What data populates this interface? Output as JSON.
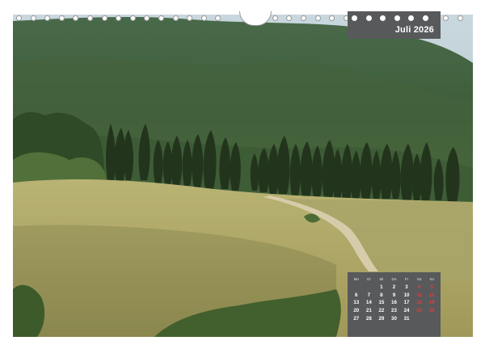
{
  "calendar": {
    "month_title": "Juli 2026",
    "weekday_headers": [
      "Mo",
      "Di",
      "Mi",
      "Do",
      "Fr",
      "Sa",
      "So"
    ],
    "weeks": [
      [
        "",
        "",
        "1",
        "2",
        "3",
        "4",
        "5"
      ],
      [
        "6",
        "7",
        "8",
        "9",
        "10",
        "11",
        "12"
      ],
      [
        "13",
        "14",
        "15",
        "16",
        "17",
        "18",
        "19"
      ],
      [
        "20",
        "21",
        "22",
        "23",
        "24",
        "25",
        "26"
      ],
      [
        "27",
        "28",
        "29",
        "30",
        "31",
        "",
        ""
      ]
    ],
    "weekend_color": "#d94040",
    "box_color": "#58595b"
  },
  "photo": {
    "subject": "Tuscan landscape with cypress row on a hill",
    "palette": {
      "sky": "#b8c9d2",
      "forest": "#3f5a33",
      "field": "#a8a365",
      "cypress": "#24351e"
    }
  }
}
